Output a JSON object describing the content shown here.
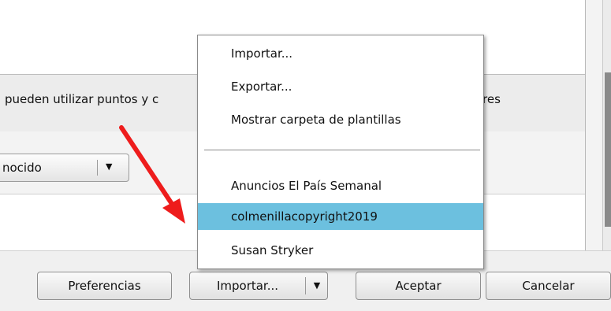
{
  "info": {
    "text_left": "pueden utilizar puntos y c",
    "text_right": "res"
  },
  "filter_combo": {
    "value": "nocido",
    "arrow_glyph": "▼"
  },
  "menu": {
    "items": [
      {
        "label": "Importar..."
      },
      {
        "label": "Exportar..."
      },
      {
        "label": "Mostrar carpeta de plantillas"
      }
    ],
    "templates": [
      {
        "label": "Anuncios El País Semanal"
      },
      {
        "label": "colmenillacopyright2019"
      },
      {
        "label": "Susan Stryker"
      }
    ],
    "selected_index": 1,
    "highlight_color": "#6cc0df"
  },
  "buttons": {
    "preferencias": "Preferencias",
    "importar": "Importar...",
    "importar_arrow": "▼",
    "aceptar": "Aceptar",
    "cancelar": "Cancelar"
  },
  "annotation": {
    "arrow_icon": "red-arrow-icon",
    "color": "#ee1c1c"
  }
}
